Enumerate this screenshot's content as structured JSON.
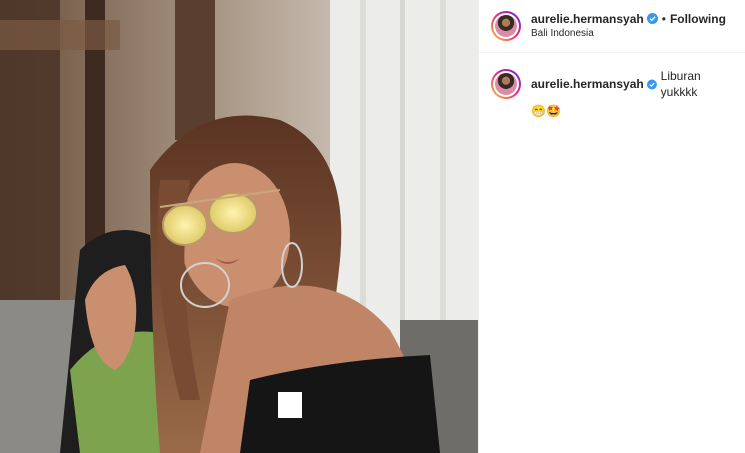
{
  "post": {
    "username": "aurelie.hermansyah",
    "follow_separator": "•",
    "follow_status": "Following",
    "location": "Bali Indonesia",
    "verified_icon": "verified-badge-icon",
    "accent": "#3897f0"
  },
  "caption": {
    "username": "aurelie.hermansyah",
    "text": "Liburan yukkkk",
    "emojis": "😁🤩"
  }
}
